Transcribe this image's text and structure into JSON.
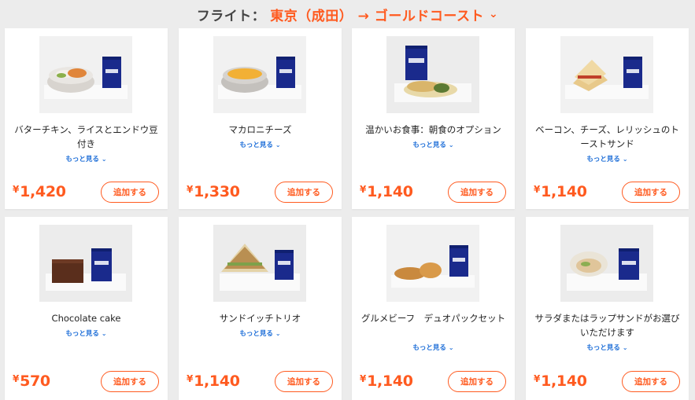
{
  "header": {
    "label": "フライト：",
    "route": "東京（成田） → ゴールドコースト",
    "chevron_icon": "chevron-down-icon"
  },
  "common": {
    "more_label": "もっと見る",
    "add_label": "追加する",
    "currency": "¥"
  },
  "items": [
    {
      "name": "バターチキン、ライスとエンドウ豆付き",
      "price": "1,420"
    },
    {
      "name": "マカロニチーズ",
      "price": "1,330"
    },
    {
      "name": "温かいお食事：朝食のオプション",
      "price": "1,140"
    },
    {
      "name": "ベーコン、チーズ、レリッシュのトーストサンド",
      "price": "1,140"
    },
    {
      "name": "Chocolate cake",
      "price": "570"
    },
    {
      "name": "サンドイッチトリオ",
      "price": "1,140"
    },
    {
      "name": "グルメビーフ　デュオパックセット",
      "price": "1,140"
    },
    {
      "name": "サラダまたはラップサンドがお選びいただけます",
      "price": "1,140"
    }
  ],
  "colors": {
    "accent": "#ff5a1f",
    "link": "#1f6fd8",
    "background": "#ececec",
    "card": "#ffffff"
  }
}
